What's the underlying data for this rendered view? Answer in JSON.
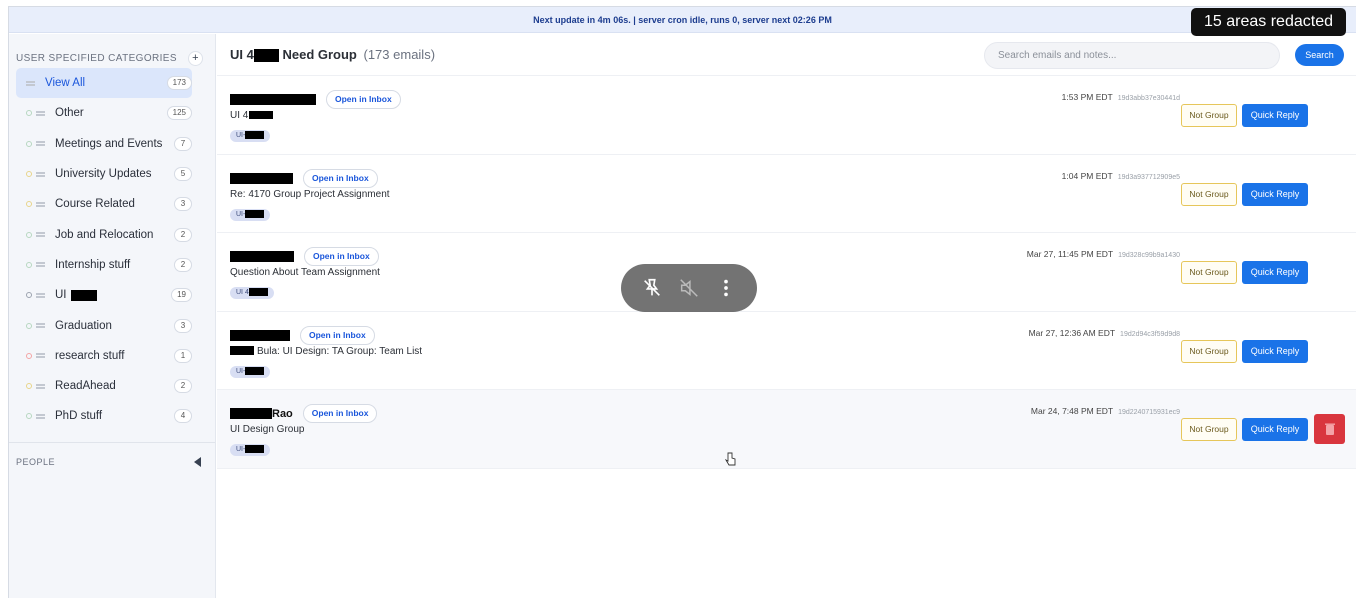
{
  "redaction_notice": "15 areas redacted",
  "topbar": {
    "status": "Next update in 4m 06s. | server cron idle, runs 0, server next 02:26 PM"
  },
  "sidebar": {
    "heading": "USER SPECIFIED CATEGORIES",
    "add_label": "+",
    "items": [
      {
        "label": "View All",
        "count": "173",
        "dot": "#9ca3af"
      },
      {
        "label": "Other",
        "count": "125",
        "dot": "#b7d7c0"
      },
      {
        "label": "Meetings and Events",
        "count": "7",
        "dot": "#b7d7c0"
      },
      {
        "label": "University Updates",
        "count": "5",
        "dot": "#e8d58a"
      },
      {
        "label": "Course Related",
        "count": "3",
        "dot": "#e8d58a"
      },
      {
        "label": "Job and Relocation",
        "count": "2",
        "dot": "#b7d7c0"
      },
      {
        "label": "Internship stuff",
        "count": "2",
        "dot": "#b7d7c0"
      },
      {
        "label": "UI",
        "count": "19",
        "dot": "#9ca3af"
      },
      {
        "label": "Graduation",
        "count": "3",
        "dot": "#b7d7c0"
      },
      {
        "label": "research stuff",
        "count": "1",
        "dot": "#f3a5a5"
      },
      {
        "label": "ReadAhead",
        "count": "2",
        "dot": "#e8d58a"
      },
      {
        "label": "PhD stuff",
        "count": "4",
        "dot": "#b7d7c0"
      }
    ],
    "people_heading": "PEOPLE"
  },
  "main": {
    "title_prefix": "UI 4",
    "title_suffix": "Need Group",
    "title_count": "(173 emails)",
    "search_placeholder": "Search emails and notes...",
    "search_button": "Search",
    "open_inbox_label": "Open in Inbox",
    "not_group_label": "Not Group",
    "quick_reply_label": "Quick Reply",
    "emails": [
      {
        "sender_suffix": "",
        "subject": "UI 4",
        "tag": "UI-",
        "time": "1:53 PM EDT",
        "hash": "19d3abb37e30441d"
      },
      {
        "sender_suffix": "",
        "subject": "Re: 4170 Group Project Assignment",
        "tag": "UI-",
        "time": "1:04 PM EDT",
        "hash": "19d3a937712909e5"
      },
      {
        "sender_suffix": "",
        "subject": "Question About Team Assignment",
        "tag": "UI 4",
        "time": "Mar 27, 11:45 PM EDT",
        "hash": "19d328c99b9a1430"
      },
      {
        "sender_suffix": "",
        "subject": "Bula: UI Design: TA Group: Team List",
        "tag": "UI-",
        "time": "Mar 27, 12:36 AM EDT",
        "hash": "19d2d94c3f59d9d8"
      },
      {
        "sender_suffix": "Rao",
        "subject": "UI Design Group",
        "tag": "UI-",
        "time": "Mar 24, 7:48 PM EDT",
        "hash": "19d2240715931ec9"
      }
    ]
  },
  "colors": {
    "accent": "#1a73e8",
    "danger": "#d9363e",
    "not_group_border": "#e6c65a"
  },
  "overlay_icons": [
    "unpin-icon",
    "mute-icon",
    "more-vertical-icon"
  ]
}
